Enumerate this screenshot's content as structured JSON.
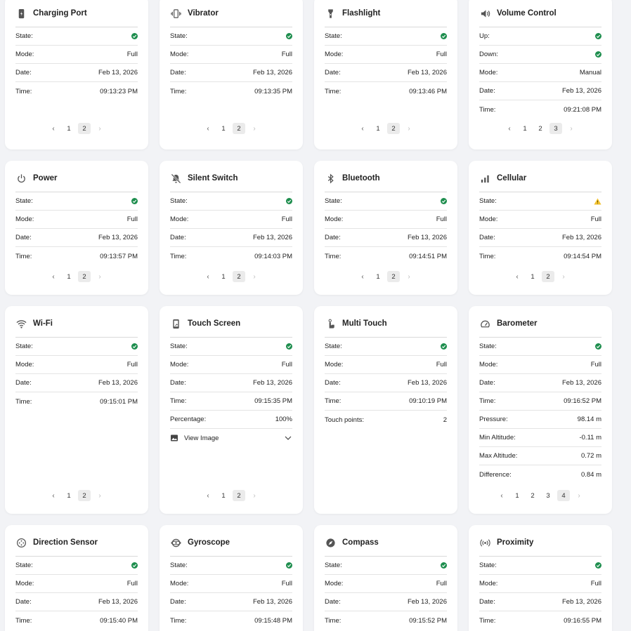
{
  "colors": {
    "ok": "#1e8e4e",
    "warn": "#f2c230"
  },
  "labels": {
    "state": "State:",
    "mode": "Mode:",
    "date": "Date:",
    "time": "Time:"
  },
  "cards": [
    {
      "title": "Charging Port",
      "icon": "charging-port-icon",
      "rows": [
        [
          "State:",
          "ok"
        ],
        [
          "Mode:",
          "Full"
        ],
        [
          "Date:",
          "Feb 13, 2026"
        ],
        [
          "Time:",
          "09:13:23 PM"
        ]
      ],
      "pages": [
        "1",
        "2"
      ],
      "current": "2"
    },
    {
      "title": "Vibrator",
      "icon": "vibrator-icon",
      "rows": [
        [
          "State:",
          "ok"
        ],
        [
          "Mode:",
          "Full"
        ],
        [
          "Date:",
          "Feb 13, 2026"
        ],
        [
          "Time:",
          "09:13:35 PM"
        ]
      ],
      "pages": [
        "1",
        "2"
      ],
      "current": "2"
    },
    {
      "title": "Flashlight",
      "icon": "flashlight-icon",
      "rows": [
        [
          "State:",
          "ok"
        ],
        [
          "Mode:",
          "Full"
        ],
        [
          "Date:",
          "Feb 13, 2026"
        ],
        [
          "Time:",
          "09:13:46 PM"
        ]
      ],
      "pages": [
        "1",
        "2"
      ],
      "current": "2"
    },
    {
      "title": "Volume Control",
      "icon": "volume-icon",
      "rows": [
        [
          "Up:",
          "ok"
        ],
        [
          "Down:",
          "ok"
        ],
        [
          "Mode:",
          "Manual"
        ],
        [
          "Date:",
          "Feb 13, 2026"
        ],
        [
          "Time:",
          "09:21:08 PM"
        ]
      ],
      "pages": [
        "1",
        "2",
        "3"
      ],
      "current": "3"
    },
    {
      "title": "Power",
      "icon": "power-icon",
      "rows": [
        [
          "State:",
          "ok"
        ],
        [
          "Mode:",
          "Full"
        ],
        [
          "Date:",
          "Feb 13, 2026"
        ],
        [
          "Time:",
          "09:13:57 PM"
        ]
      ],
      "pages": [
        "1",
        "2"
      ],
      "current": "2"
    },
    {
      "title": "Silent Switch",
      "icon": "silent-bell-icon",
      "rows": [
        [
          "State:",
          "ok"
        ],
        [
          "Mode:",
          "Full"
        ],
        [
          "Date:",
          "Feb 13, 2026"
        ],
        [
          "Time:",
          "09:14:03 PM"
        ]
      ],
      "pages": [
        "1",
        "2"
      ],
      "current": "2"
    },
    {
      "title": "Bluetooth",
      "icon": "bluetooth-icon",
      "rows": [
        [
          "State:",
          "ok"
        ],
        [
          "Mode:",
          "Full"
        ],
        [
          "Date:",
          "Feb 13, 2026"
        ],
        [
          "Time:",
          "09:14:51 PM"
        ]
      ],
      "pages": [
        "1",
        "2"
      ],
      "current": "2"
    },
    {
      "title": "Cellular",
      "icon": "cellular-signal-icon",
      "rows": [
        [
          "State:",
          "warn"
        ],
        [
          "Mode:",
          "Full"
        ],
        [
          "Date:",
          "Feb 13, 2026"
        ],
        [
          "Time:",
          "09:14:54 PM"
        ]
      ],
      "pages": [
        "1",
        "2"
      ],
      "current": "2"
    },
    {
      "title": "Wi-Fi",
      "icon": "wifi-icon",
      "rows": [
        [
          "State:",
          "ok"
        ],
        [
          "Mode:",
          "Full"
        ],
        [
          "Date:",
          "Feb 13, 2026"
        ],
        [
          "Time:",
          "09:15:01 PM"
        ]
      ],
      "pages": [
        "1",
        "2"
      ],
      "current": "2"
    },
    {
      "title": "Touch Screen",
      "icon": "touch-screen-icon",
      "rows": [
        [
          "State:",
          "ok"
        ],
        [
          "Mode:",
          "Full"
        ],
        [
          "Date:",
          "Feb 13, 2026"
        ],
        [
          "Time:",
          "09:15:35 PM"
        ],
        [
          "Percentage:",
          "100%"
        ]
      ],
      "view_image": "View Image",
      "pages": [
        "1",
        "2"
      ],
      "current": "2"
    },
    {
      "title": "Multi Touch",
      "icon": "multi-touch-hand-icon",
      "rows": [
        [
          "State:",
          "ok"
        ],
        [
          "Mode:",
          "Full"
        ],
        [
          "Date:",
          "Feb 13, 2026"
        ],
        [
          "Time:",
          "09:10:19 PM"
        ],
        [
          "Touch points:",
          "2"
        ]
      ],
      "pages": [],
      "current": ""
    },
    {
      "title": "Barometer",
      "icon": "barometer-gauge-icon",
      "rows": [
        [
          "State:",
          "ok"
        ],
        [
          "Mode:",
          "Full"
        ],
        [
          "Date:",
          "Feb 13, 2026"
        ],
        [
          "Time:",
          "09:16:52 PM"
        ],
        [
          "Pressure:",
          "98.14 m"
        ],
        [
          "Min Altitude:",
          "-0.11 m"
        ],
        [
          "Max Altitude:",
          "0.72 m"
        ],
        [
          "Difference:",
          "0.84 m"
        ]
      ],
      "pages": [
        "1",
        "2",
        "3",
        "4"
      ],
      "current": "4"
    },
    {
      "title": "Direction Sensor",
      "icon": "direction-sensor-icon",
      "rows": [
        [
          "State:",
          "ok"
        ],
        [
          "Mode:",
          "Full"
        ],
        [
          "Date:",
          "Feb 13, 2026"
        ],
        [
          "Time:",
          "09:15:40 PM"
        ]
      ],
      "pages": [],
      "current": ""
    },
    {
      "title": "Gyroscope",
      "icon": "gyroscope-icon",
      "rows": [
        [
          "State:",
          "ok"
        ],
        [
          "Mode:",
          "Full"
        ],
        [
          "Date:",
          "Feb 13, 2026"
        ],
        [
          "Time:",
          "09:15:48 PM"
        ]
      ],
      "pages": [],
      "current": ""
    },
    {
      "title": "Compass",
      "icon": "compass-icon",
      "rows": [
        [
          "State:",
          "ok"
        ],
        [
          "Mode:",
          "Full"
        ],
        [
          "Date:",
          "Feb 13, 2026"
        ],
        [
          "Time:",
          "09:15:52 PM"
        ]
      ],
      "pages": [],
      "current": ""
    },
    {
      "title": "Proximity",
      "icon": "proximity-icon",
      "rows": [
        [
          "State:",
          "ok"
        ],
        [
          "Mode:",
          "Full"
        ],
        [
          "Date:",
          "Feb 13, 2026"
        ],
        [
          "Time:",
          "09:16:55 PM"
        ]
      ],
      "pages": [],
      "current": ""
    }
  ]
}
